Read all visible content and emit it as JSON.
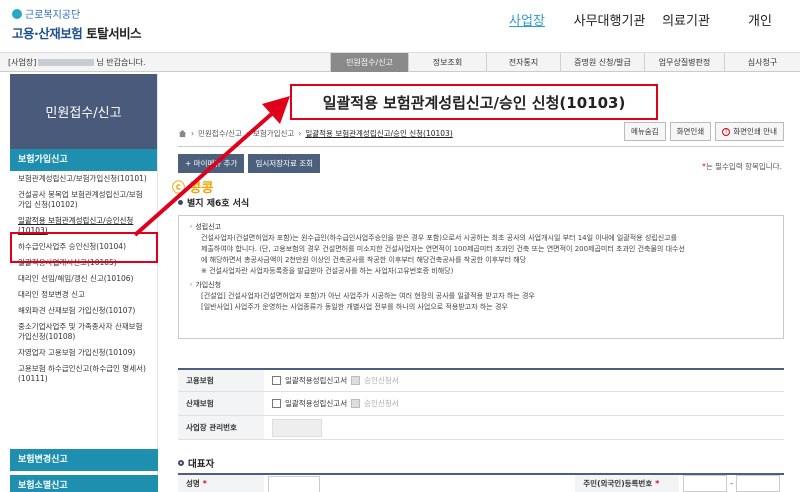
{
  "header": {
    "org": "근로복지공단",
    "service_a": "고용·산재보험",
    "service_b": "토탈서비스",
    "nav": [
      "사업장",
      "사무대행기관",
      "의료기관",
      "개인"
    ],
    "nav_active": 0
  },
  "subbar": {
    "welcome_prefix": "[사업장]",
    "welcome_suffix": "님 반갑습니다.",
    "tabs": [
      "민원접수/신고",
      "정보조회",
      "전자통지",
      "증명원 신청/발급",
      "업무상질병판정",
      "심사청구"
    ],
    "active_tab": 0
  },
  "sidebar": {
    "title": "민원접수/신고",
    "section1": "보험가입신고",
    "items": [
      "보험관계성립신고/보험가입신청(10101)",
      "건설공사 봉복업 보험관계성립신고/보험가입 신청(10102)",
      "일괄적용 보험관계성립신고/승인신청(10103)",
      "하수급인사업주 승인신청(10104)",
      "일괄적용사업개시신고(10105)",
      "대리인 선임/해임/갱신 신고(10106)",
      "대리인 정보변경 신고",
      "해외파견 산재보험 가입신청(10107)",
      "중소기업사업주 및 가족종사자 산재보험가입신청(10108)",
      "자영업자 고용보험 가입신청(10109)",
      "고용보험 하수급인신고(하수급인 명세서)(10111)"
    ],
    "current_index": 2,
    "section2": "보험변경신고",
    "section3": "보험소멸신고"
  },
  "main": {
    "title": "일괄적용 보험관계성립신고/승인 신청(10103)",
    "breadcrumb": [
      "민원접수/신고",
      "보험가입신고",
      "일괄적용 보험관계성립신고/승인 신청(10103)"
    ],
    "buttons": {
      "menu": "메뉴숨김",
      "print": "화면인쇄",
      "guide": "화면인쇄 안내"
    },
    "my_menu": "+ 마이메뉴 추가",
    "temp_save": "임시저장자료 조회",
    "required_note_star": "*",
    "required_note": "는 필수입력 항목입니다.",
    "watermark": "ⓒ 콩콩",
    "form_title": "별지 제6호 서식",
    "info": [
      {
        "title": "◦ 성립신고",
        "lines": [
          "건설사업자(건설면허업자 포함)는 원수급인(하수급인사업주승인을 받은 경우 포함)으로서 시공하는 최초 공사의 사업개시일 부터 14일 이내에 일괄적용 성립신고를",
          "제출하여야 합니다. (단, 고용보험의 경우 건설면허를 미소지한 건설사업자는 연면적이 100제곱미터 초과인 건축 또는 연면적이 200제곱미터 초과인 건축물의 대수선",
          "에 해당하면서 총공사금액이 2천만원 이상인 건축공사를 착공한 이후부터 해당건축공사를 착공한 이후부터 해당",
          "※ 건설사업자란 사업자등록증을 발급받아 건설공사를 하는 사업자(고유번호증 비해당)"
        ]
      },
      {
        "title": "◦ 가입신청",
        "lines": [
          "[건설업] 건설사업자(건설면허업자 포함)가 아닌 사업주가 시공하는 여러 현장의 공사를 일괄적용 받고자 하는 경우",
          "[일반사업] 사업주가 운영하는 사업종류가 동일한 개별사업 전부를 하나의 사업으로 적용받고자 하는 경우"
        ]
      }
    ],
    "form": [
      {
        "label": "고용보험",
        "opt1": "일괄적용성립신고서",
        "opt2": "승인신청서"
      },
      {
        "label": "산재보험",
        "opt1": "일괄적용성립신고서",
        "opt2": "승인신청서"
      },
      {
        "label": "사업장 관리번호"
      }
    ],
    "rep_title": "대표자",
    "rep_name_label": "성명",
    "rep_id_label": "주민(외국인)등록번호",
    "rep_dash": "-"
  }
}
